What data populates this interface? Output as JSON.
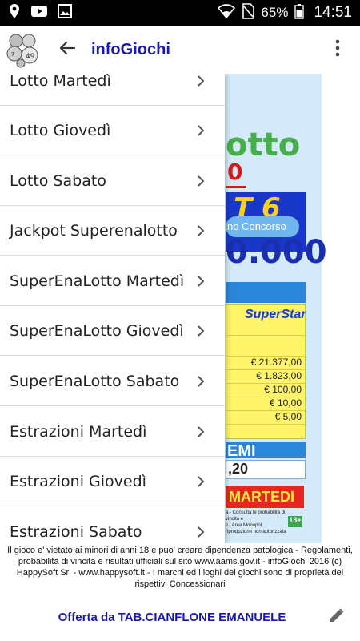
{
  "status_bar": {
    "battery": "65%",
    "time": "14:51",
    "icons": [
      "location-icon",
      "youtube-icon",
      "image-icon",
      "wifi-icon",
      "no-sim-icon",
      "battery-icon"
    ]
  },
  "app_bar": {
    "title": "infoGiochi",
    "title_color": "#1a1aa8",
    "icons": [
      "app-logo-icon",
      "back-arrow-icon",
      "overflow-menu-icon"
    ]
  },
  "drawer": {
    "items": [
      {
        "label": "Lotto Martedì"
      },
      {
        "label": "Lotto Giovedì"
      },
      {
        "label": "Lotto Sabato"
      },
      {
        "label": "Jackpot Superenalotto"
      },
      {
        "label": "SuperEnaLotto Martedì"
      },
      {
        "label": "SuperEnaLotto Giovedì"
      },
      {
        "label": "SuperEnaLotto Sabato"
      },
      {
        "label": "Estrazioni Martedì"
      },
      {
        "label": "Estrazioni Giovedì"
      },
      {
        "label": "Estrazioni Sabato"
      }
    ],
    "chevron_icon": "chevron-right-icon"
  },
  "background_content": {
    "title_fragment": "otto",
    "year_fragment": "0",
    "banner_fragment": "T 6",
    "pill_fragment": "no Concorso",
    "amount_fragment": "0.000",
    "superstar": "SuperStar",
    "table_rows": [
      "€ 21.377,00",
      "€ 1.823,00",
      "€ 100,00",
      "€ 10,00",
      "€ 5,00"
    ],
    "premi_fragment": "EMI",
    "premi_value_fragment": ",20",
    "red_band_fragment": "MARTEDI",
    "fineprint_lines": [
      "a - Consulta le probabilità di vincita e",
      "li - Area Monopoli",
      "riproduzione non autorizzata"
    ],
    "age_badge": "18+"
  },
  "footer": {
    "note": "Il gioco e' vietato ai minori di anni 18 e puo' creare dipendenza patologica - Regolamenti, probabilità di vincita e risultati ufficiali sul sito www.aams.gov.it - infoGiochi 2016 (c) HappySoft Srl - www.happysoft.it - I marchi ed i loghi dei giochi sono di proprietà dei rispettivi Concessionari",
    "offer": "Offerta da TAB.CIANFLONE EMANUELE",
    "edit_icon": "edit-pencil-icon"
  }
}
